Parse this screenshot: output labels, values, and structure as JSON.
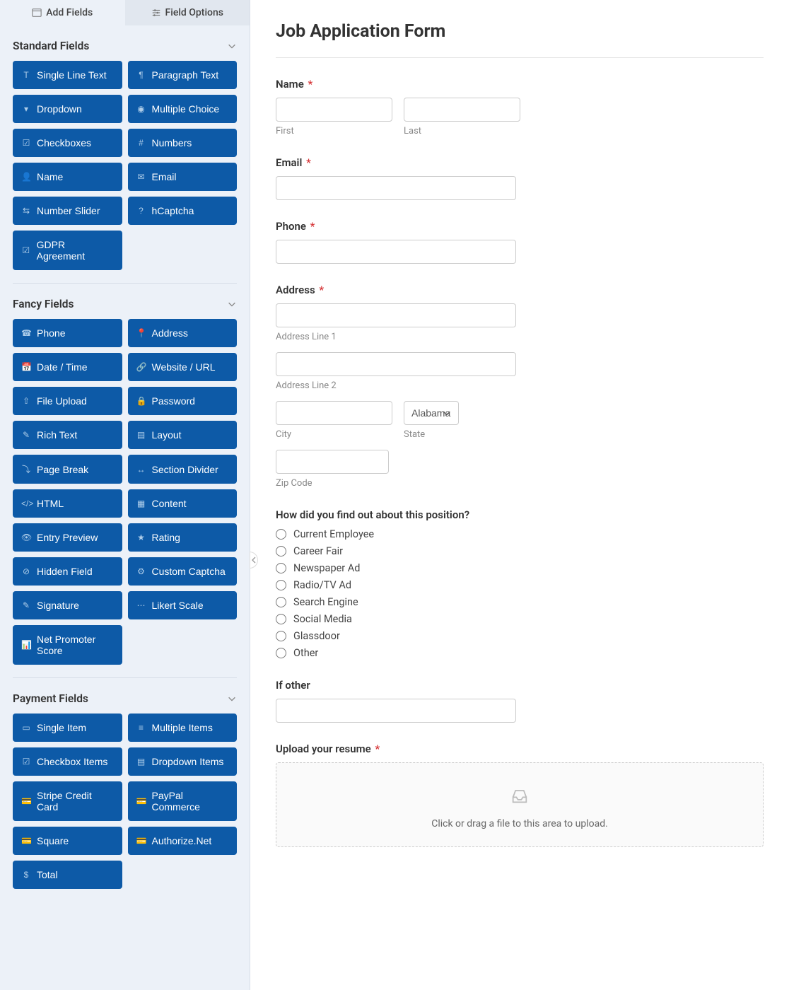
{
  "tabs": {
    "add_fields": "Add Fields",
    "field_options": "Field Options"
  },
  "sections": {
    "standard": {
      "title": "Standard Fields",
      "items": [
        "Single Line Text",
        "Paragraph Text",
        "Dropdown",
        "Multiple Choice",
        "Checkboxes",
        "Numbers",
        "Name",
        "Email",
        "Number Slider",
        "hCaptcha",
        "GDPR Agreement"
      ]
    },
    "fancy": {
      "title": "Fancy Fields",
      "items": [
        "Phone",
        "Address",
        "Date / Time",
        "Website / URL",
        "File Upload",
        "Password",
        "Rich Text",
        "Layout",
        "Page Break",
        "Section Divider",
        "HTML",
        "Content",
        "Entry Preview",
        "Rating",
        "Hidden Field",
        "Custom Captcha",
        "Signature",
        "Likert Scale",
        "Net Promoter Score"
      ]
    },
    "payment": {
      "title": "Payment Fields",
      "items": [
        "Single Item",
        "Multiple Items",
        "Checkbox Items",
        "Dropdown Items",
        "Stripe Credit Card",
        "PayPal Commerce",
        "Square",
        "Authorize.Net",
        "Total"
      ]
    }
  },
  "form": {
    "title": "Job Application Form",
    "name": {
      "label": "Name",
      "first": "First",
      "last": "Last"
    },
    "email": {
      "label": "Email"
    },
    "phone": {
      "label": "Phone"
    },
    "address": {
      "label": "Address",
      "line1": "Address Line 1",
      "line2": "Address Line 2",
      "city": "City",
      "state_label": "State",
      "state_value": "Alabama",
      "zip": "Zip Code"
    },
    "source": {
      "label": "How did you find out about this position?",
      "options": [
        "Current Employee",
        "Career Fair",
        "Newspaper Ad",
        "Radio/TV Ad",
        "Search Engine",
        "Social Media",
        "Glassdoor",
        "Other"
      ]
    },
    "other": {
      "label": "If other"
    },
    "resume": {
      "label": "Upload your resume",
      "hint": "Click or drag a file to this area to upload."
    }
  }
}
